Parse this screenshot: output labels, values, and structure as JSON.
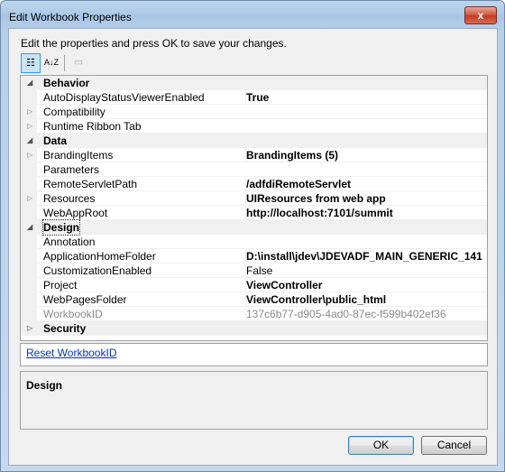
{
  "window": {
    "title": "Edit Workbook Properties",
    "close_label": "x"
  },
  "instruction": "Edit the properties and press OK to save your changes.",
  "toolbar": {
    "categorized_label": "☷",
    "alpha_label": "A↓Z",
    "pages_label": "▭"
  },
  "rows": [
    {
      "kind": "cat",
      "name": "Behavior",
      "expanded": true
    },
    {
      "kind": "prop",
      "name": "AutoDisplayStatusViewerEnabled",
      "value": "True",
      "bold": true,
      "expandable": false
    },
    {
      "kind": "prop",
      "name": "Compatibility",
      "value": "",
      "bold": false,
      "expandable": true
    },
    {
      "kind": "prop",
      "name": "Runtime Ribbon Tab",
      "value": "",
      "bold": false,
      "expandable": true
    },
    {
      "kind": "cat",
      "name": "Data",
      "expanded": true
    },
    {
      "kind": "prop",
      "name": "BrandingItems",
      "value": "BrandingItems (5)",
      "bold": true,
      "expandable": true
    },
    {
      "kind": "prop",
      "name": "Parameters",
      "value": "",
      "bold": false,
      "expandable": false
    },
    {
      "kind": "prop",
      "name": "RemoteServletPath",
      "value": "/adfdiRemoteServlet",
      "bold": true,
      "expandable": false
    },
    {
      "kind": "prop",
      "name": "Resources",
      "value": "UIResources from web app",
      "bold": true,
      "expandable": true
    },
    {
      "kind": "prop",
      "name": "WebAppRoot",
      "value": "http://localhost:7101/summit",
      "bold": true,
      "expandable": false
    },
    {
      "kind": "cat",
      "name": "Design",
      "expanded": true,
      "selected": true
    },
    {
      "kind": "prop",
      "name": "Annotation",
      "value": "",
      "bold": false,
      "expandable": false
    },
    {
      "kind": "prop",
      "name": "ApplicationHomeFolder",
      "value": "D:\\install\\jdev\\JDEVADF_MAIN_GENERIC_141",
      "bold": true,
      "expandable": false
    },
    {
      "kind": "prop",
      "name": "CustomizationEnabled",
      "value": "False",
      "bold": false,
      "expandable": false
    },
    {
      "kind": "prop",
      "name": "Project",
      "value": "ViewController",
      "bold": true,
      "expandable": false
    },
    {
      "kind": "prop",
      "name": "WebPagesFolder",
      "value": "ViewController\\public_html",
      "bold": true,
      "expandable": false
    },
    {
      "kind": "prop",
      "name": "WorkbookID",
      "value": "137c6b77-d905-4ad0-87ec-f599b402ef36",
      "bold": false,
      "grey": true,
      "expandable": false
    },
    {
      "kind": "cat",
      "name": "Security",
      "expanded": false
    }
  ],
  "command_link": "Reset WorkbookID",
  "help": {
    "title": "Design"
  },
  "buttons": {
    "ok": "OK",
    "cancel": "Cancel"
  }
}
